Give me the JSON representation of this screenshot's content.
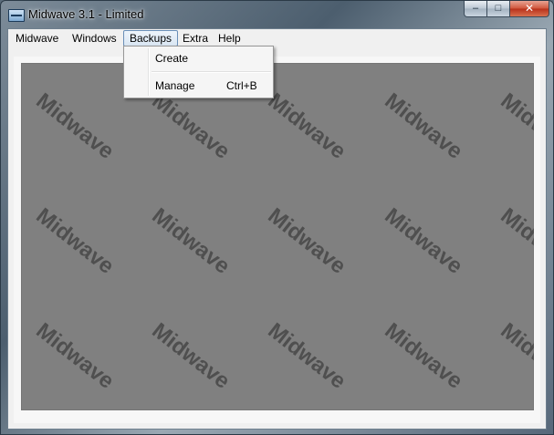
{
  "window": {
    "title": "Midwave 3.1 - Limited",
    "controls": {
      "minimize": "–",
      "maximize": "□",
      "close": "✕"
    }
  },
  "menubar": {
    "items": [
      {
        "label": "Midwave"
      },
      {
        "label": "Windows"
      },
      {
        "label": "Backups",
        "active": true
      },
      {
        "label": "Extra"
      },
      {
        "label": "Help"
      }
    ]
  },
  "backups_menu": {
    "items": [
      {
        "label": "Create",
        "shortcut": ""
      },
      {
        "label": "Manage",
        "shortcut": "Ctrl+B"
      }
    ]
  },
  "canvas": {
    "watermark_text": "Midwave",
    "background_color": "#808080",
    "watermark_color": "#4f4f4f"
  },
  "colors": {
    "menu_highlight_border": "#6a8fb8",
    "close_button": "#c9432a"
  },
  "icons": {
    "app": "app-window-icon",
    "minimize": "minimize-icon",
    "maximize": "maximize-icon",
    "close": "close-icon"
  }
}
